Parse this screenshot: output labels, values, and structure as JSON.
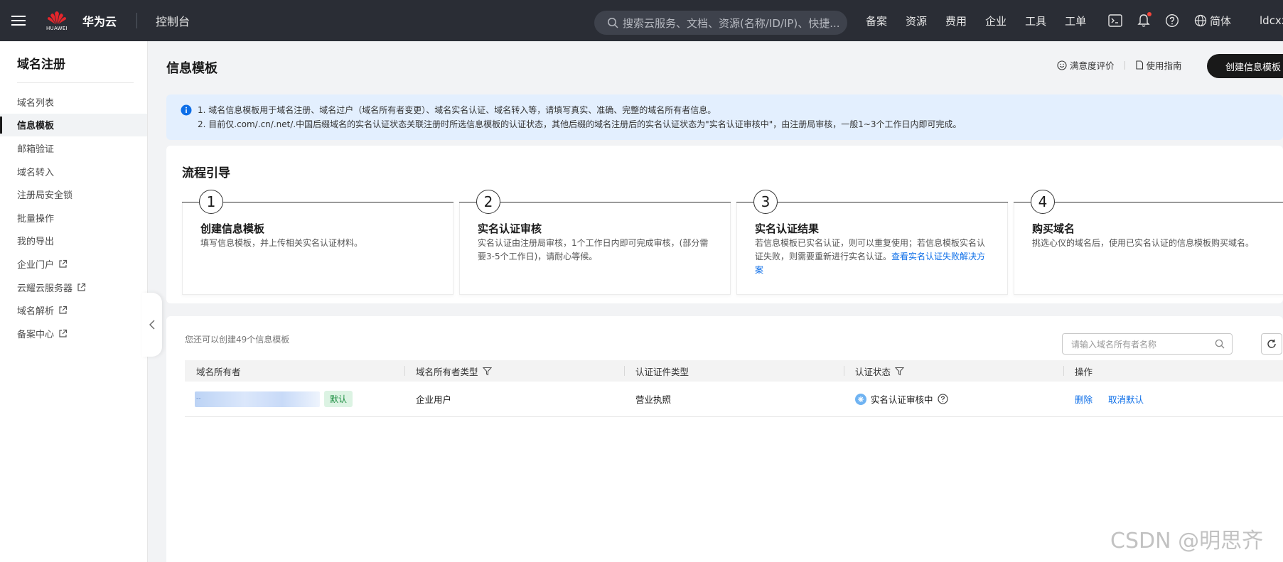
{
  "topbar": {
    "brand_logo_text": "HUAWEI",
    "brand_name": "华为云",
    "console": "控制台",
    "search_placeholder": "搜索云服务、文档、资源(名称/ID/IP)、快捷...",
    "nav": [
      "备案",
      "资源",
      "费用",
      "企业",
      "工具",
      "工单"
    ],
    "lang": "简体",
    "user": "ldcxx"
  },
  "sidebar": {
    "title": "域名注册",
    "items": [
      {
        "label": "域名列表",
        "external": false
      },
      {
        "label": "信息模板",
        "external": false,
        "active": true
      },
      {
        "label": "邮箱验证",
        "external": false
      },
      {
        "label": "域名转入",
        "external": false
      },
      {
        "label": "注册局安全锁",
        "external": false
      },
      {
        "label": "批量操作",
        "external": false
      },
      {
        "label": "我的导出",
        "external": false
      },
      {
        "label": "企业门户",
        "external": true
      },
      {
        "label": "云耀云服务器",
        "external": true
      },
      {
        "label": "域名解析",
        "external": true
      },
      {
        "label": "备案中心",
        "external": true
      }
    ]
  },
  "page": {
    "title": "信息模板",
    "rating_link": "满意度评价",
    "guide_link": "使用指南",
    "create_button": "创建信息模板"
  },
  "notice": {
    "line1": "1. 域名信息模板用于域名注册、域名过户（域名所有者变更）、域名实名认证、域名转入等，请填写真实、准确、完整的域名所有者信息。",
    "line2": "2. 目前仅.com/.cn/.net/.中国后缀域名的实名认证状态关联注册时所选信息模板的认证状态，其他后缀的域名注册后的实名认证状态为\"实名认证审核中\"，由注册局审核，一般1~3个工作日内即可完成。"
  },
  "flow": {
    "title": "流程引导",
    "steps": [
      {
        "num": "1",
        "title": "创建信息模板",
        "desc": "填写信息模板，并上传相关实名认证材料。",
        "link": ""
      },
      {
        "num": "2",
        "title": "实名认证审核",
        "desc": "实名认证由注册局审核，1个工作日内即可完成审核，(部分需要3-5个工作日)，请耐心等候。",
        "link": ""
      },
      {
        "num": "3",
        "title": "实名认证结果",
        "desc": "若信息模板已实名认证，则可以重复使用；若信息模板实名认证失败，则需要重新进行实名认证。",
        "link": "查看实名认证失败解决方案"
      },
      {
        "num": "4",
        "title": "购买域名",
        "desc": "挑选心仪的域名后，使用已实名认证的信息模板购买域名。",
        "link": ""
      }
    ]
  },
  "table": {
    "remaining": "您还可以创建49个信息模板",
    "search_placeholder": "请输入域名所有者名称",
    "columns": [
      "域名所有者",
      "域名所有者类型",
      "认证证件类型",
      "认证状态",
      "操作"
    ],
    "rows": [
      {
        "owner": "--",
        "default_badge": "默认",
        "owner_type": "企业用户",
        "cert_type": "营业执照",
        "status": "实名认证审核中",
        "actions": [
          "删除",
          "取消默认"
        ]
      }
    ]
  },
  "watermark": "CSDN @明思齐",
  "colors": {
    "topbar": "#2a2d35",
    "link": "#0c6ee8",
    "notice_bg": "#e3effe",
    "badge_bg": "#dcf3e3"
  }
}
